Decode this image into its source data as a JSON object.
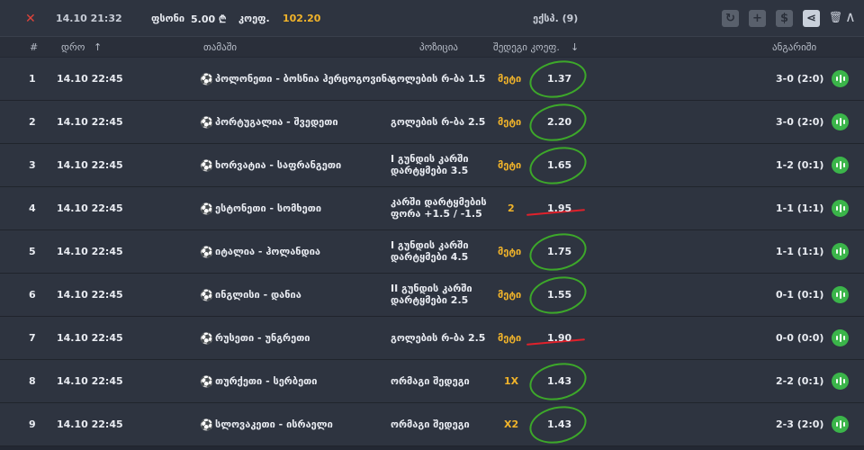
{
  "header": {
    "date": "14.10  21:32",
    "stake_label": "ფსონი",
    "stake_value": "5.00 ₾",
    "coef_label": "კოეფ.",
    "coef_value": "102.20",
    "bet_type": "ექსპ. (9)"
  },
  "columns": {
    "num": "#",
    "date": "დრო",
    "game": "თამაში",
    "position": "პოზიცია",
    "selection_coef": "შედეგი კოეფ.",
    "result": "ანგარიში"
  },
  "rows": [
    {
      "num": "1",
      "date": "14.10  22:45",
      "game": "პოლონეთი - ბოსნია ჰერცოგოვინა",
      "position": "გოლების რ-ბა 1.5",
      "selection": "მეტი",
      "coef": "1.37",
      "result": "3-0 (2:0)",
      "mark": "circle"
    },
    {
      "num": "2",
      "date": "14.10  22:45",
      "game": "პორტუგალია - შვედეთი",
      "position": "გოლების რ-ბა 2.5",
      "selection": "მეტი",
      "coef": "2.20",
      "result": "3-0 (2:0)",
      "mark": "circle"
    },
    {
      "num": "3",
      "date": "14.10  22:45",
      "game": "ხორვატია - საფრანგეთი",
      "position": "I გუნდის კარში დარტყმები 3.5",
      "selection": "მეტი",
      "coef": "1.65",
      "result": "1-2 (0:1)",
      "mark": "circle"
    },
    {
      "num": "4",
      "date": "14.10  22:45",
      "game": "ესტონეთი - სომხეთი",
      "position": "კარში დარტყმების ფორა +1.5 / -1.5",
      "selection": "2",
      "coef": "1.95",
      "result": "1-1 (1:1)",
      "mark": "line"
    },
    {
      "num": "5",
      "date": "14.10  22:45",
      "game": "იტალია - ჰოლანდია",
      "position": "I გუნდის კარში დარტყმები 4.5",
      "selection": "მეტი",
      "coef": "1.75",
      "result": "1-1 (1:1)",
      "mark": "circle"
    },
    {
      "num": "6",
      "date": "14.10  22:45",
      "game": "ინგლისი - დანია",
      "position": "II გუნდის კარში დარტყმები 2.5",
      "selection": "მეტი",
      "coef": "1.55",
      "result": "0-1 (0:1)",
      "mark": "circle"
    },
    {
      "num": "7",
      "date": "14.10  22:45",
      "game": "რუსეთი - უნგრეთი",
      "position": "გოლების რ-ბა 2.5",
      "selection": "მეტი",
      "coef": "1.90",
      "result": "0-0 (0:0)",
      "mark": "line"
    },
    {
      "num": "8",
      "date": "14.10  22:45",
      "game": "თურქეთი - სერბეთი",
      "position": "ორმაგი შედეგი",
      "selection": "1X",
      "coef": "1.43",
      "result": "2-2 (0:1)",
      "mark": "circle"
    },
    {
      "num": "9",
      "date": "14.10  22:45",
      "game": "სლოვაკეთი - ისრაელი",
      "position": "ორმაგი შედეგი",
      "selection": "X2",
      "coef": "1.43",
      "result": "2-3 (2:0)",
      "mark": "circle"
    }
  ],
  "colors": {
    "accent": "#f2b42a",
    "success": "#3bb54a",
    "fail": "#e0212b",
    "bg": "#2e3440"
  }
}
